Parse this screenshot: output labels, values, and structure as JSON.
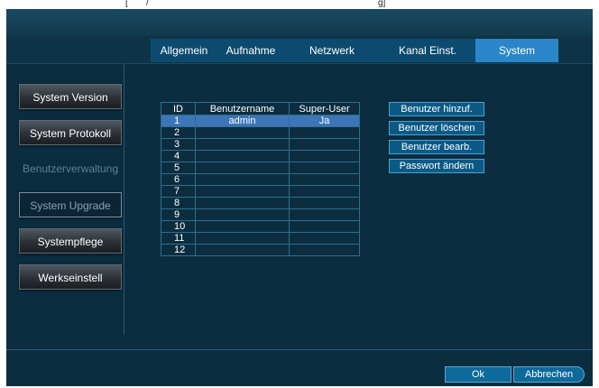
{
  "top_fragments": [
    "[",
    "/",
    "g]"
  ],
  "tabs": [
    "Allgemein",
    "Aufnahme",
    "Netzwerk",
    "Kanal Einst.",
    "System"
  ],
  "active_tab": "System",
  "sidebar": [
    {
      "label": "System Version",
      "state": "normal"
    },
    {
      "label": "System Protokoll",
      "state": "normal"
    },
    {
      "label": "Benutzerverwaltung",
      "state": "disabled"
    },
    {
      "label": "System Upgrade",
      "state": "selected"
    },
    {
      "label": "Systempflege",
      "state": "normal"
    },
    {
      "label": "Werkseinstell",
      "state": "normal"
    }
  ],
  "table": {
    "headers": [
      "ID",
      "Benutzername",
      "Super-User"
    ],
    "rows": [
      [
        "1",
        "admin",
        "Ja"
      ],
      [
        "2",
        "",
        ""
      ],
      [
        "3",
        "",
        ""
      ],
      [
        "4",
        "",
        ""
      ],
      [
        "5",
        "",
        ""
      ],
      [
        "6",
        "",
        ""
      ],
      [
        "7",
        "",
        ""
      ],
      [
        "8",
        "",
        ""
      ],
      [
        "9",
        "",
        ""
      ],
      [
        "10",
        "",
        ""
      ],
      [
        "11",
        "",
        ""
      ],
      [
        "12",
        "",
        ""
      ]
    ],
    "selected_row": 0
  },
  "actions": [
    "Benutzer hinzuf.",
    "Benutzer löschen",
    "Benutzer bearb.",
    "Passwort ändern"
  ],
  "footer": {
    "ok_label": "Ok",
    "cancel_label": "Abbrechen"
  },
  "colors": {
    "background": "#0f3346",
    "tab_active": "#2a86c8",
    "selection": "#3d76b6"
  }
}
